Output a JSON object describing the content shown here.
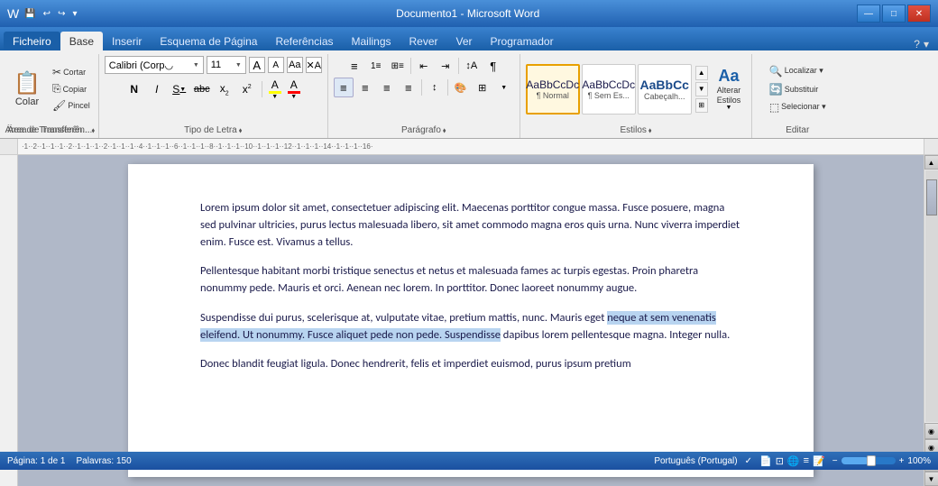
{
  "titleBar": {
    "title": "Documento1 - Microsoft Word",
    "minimize": "—",
    "maximize": "□",
    "close": "✕"
  },
  "tabs": [
    {
      "label": "Ficheiro",
      "active": false
    },
    {
      "label": "Base",
      "active": true
    },
    {
      "label": "Inserir",
      "active": false
    },
    {
      "label": "Esquema de Página",
      "active": false
    },
    {
      "label": "Referências",
      "active": false
    },
    {
      "label": "Mailings",
      "active": false
    },
    {
      "label": "Rever",
      "active": false
    },
    {
      "label": "Ver",
      "active": false
    },
    {
      "label": "Programador",
      "active": false
    }
  ],
  "ribbon": {
    "clipboard": {
      "label": "Área de Transferên...",
      "paste": "Colar",
      "cut": "Cortar",
      "copy": "Copiar",
      "paintFormat": "Pincel"
    },
    "font": {
      "label": "Tipo de Letra",
      "name": "Calibri (Corp◡",
      "size": "11",
      "bold": "N",
      "italic": "I",
      "underline": "S",
      "strikethrough": "abc",
      "subscript": "x₂",
      "superscript": "x²",
      "highlight": "A",
      "fontColor": "A"
    },
    "paragraph": {
      "label": "Parágrafo"
    },
    "styles": {
      "label": "Estilos",
      "items": [
        {
          "preview": "AaBbCcDc",
          "label": "¶ Normal",
          "active": true
        },
        {
          "preview": "AaBbCcDc",
          "label": "¶ Sem Es...",
          "active": false
        },
        {
          "preview": "AaBbCc",
          "label": "Cabeçalh...",
          "active": false
        }
      ],
      "alterarEstilos": "Alterar\nEstilos"
    },
    "edit": {
      "label": "Editar",
      "localizar": "Localizar ▾",
      "substituir": "Substituir",
      "selecionar": "Selecionar ▾"
    }
  },
  "document": {
    "paragraphs": [
      "Lorem ipsum dolor sit amet, consectetuer adipiscing elit. Maecenas porttitor congue massa. Fusce posuere, magna sed pulvinar ultricies, purus lectus malesuada libero, sit amet commodo magna eros quis urna. Nunc viverra imperdiet enim. Fusce est. Vivamus a tellus.",
      "Pellentesque habitant morbi tristique senectus et netus et malesuada fames ac turpis egestas. Proin pharetra nonummy pede. Mauris et orci. Aenean nec lorem. In porttitor. Donec laoreet nonummy augue.",
      "highlight",
      "Donec blandit feugiat ligula. Donec hendrerit, felis et imperdiet euismod, purus ipsum pretium"
    ],
    "para3_before": "Suspendisse dui purus, scelerisque at, vulputate vitae, pretium mattis, nunc. Mauris eget ",
    "para3_highlight": "neque at sem venenatis eleifend. Ut nonummy. Fusce aliquet pede non pede. Suspendisse",
    "para3_after": " dapibus lorem pellentesque magna. Integer nulla."
  },
  "statusBar": {
    "pageInfo": "Página: 1 de 1",
    "wordCount": "Palavras: 150",
    "language": "Português (Portugal)"
  }
}
